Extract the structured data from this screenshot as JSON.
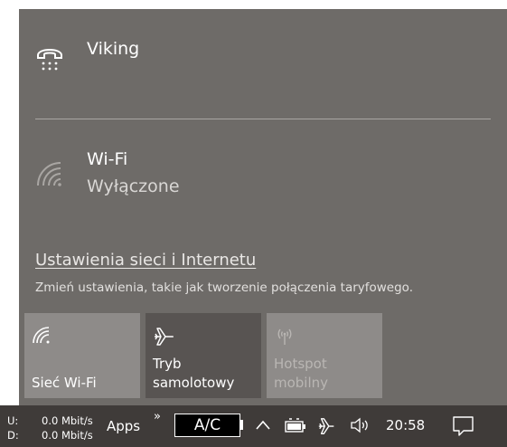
{
  "networks": [
    {
      "name": "Viking",
      "status": "",
      "icon": "dialup-phone-icon"
    },
    {
      "name": "Wi-Fi",
      "status": "Wyłączone",
      "icon": "wifi-icon"
    }
  ],
  "settings": {
    "link": "Ustawienia sieci i Internetu",
    "description": "Zmień ustawienia, takie jak tworzenie połączenia taryfowego."
  },
  "quick_actions": [
    {
      "label": "Sieć Wi-Fi",
      "icon": "wifi-icon",
      "state": "off"
    },
    {
      "label": "Tryb samolotowy",
      "icon": "airplane-icon",
      "state": "off"
    },
    {
      "label": "Hotspot mobilny",
      "icon": "hotspot-icon",
      "state": "disabled"
    }
  ],
  "taskbar": {
    "net_meter": {
      "up_label": "U:",
      "up_value": "0.0 Mbit/s",
      "down_label": "D:",
      "down_value": "0.0 Mbit/s"
    },
    "apps": "Apps",
    "chevron": "»",
    "ac": "A/C",
    "clock": "20:58"
  },
  "colors": {
    "flyout_bg": "#6e6b68",
    "tile_off": "#8e8b89",
    "tile_dark": "#585452",
    "taskbar_bg": "#3f3b39"
  }
}
